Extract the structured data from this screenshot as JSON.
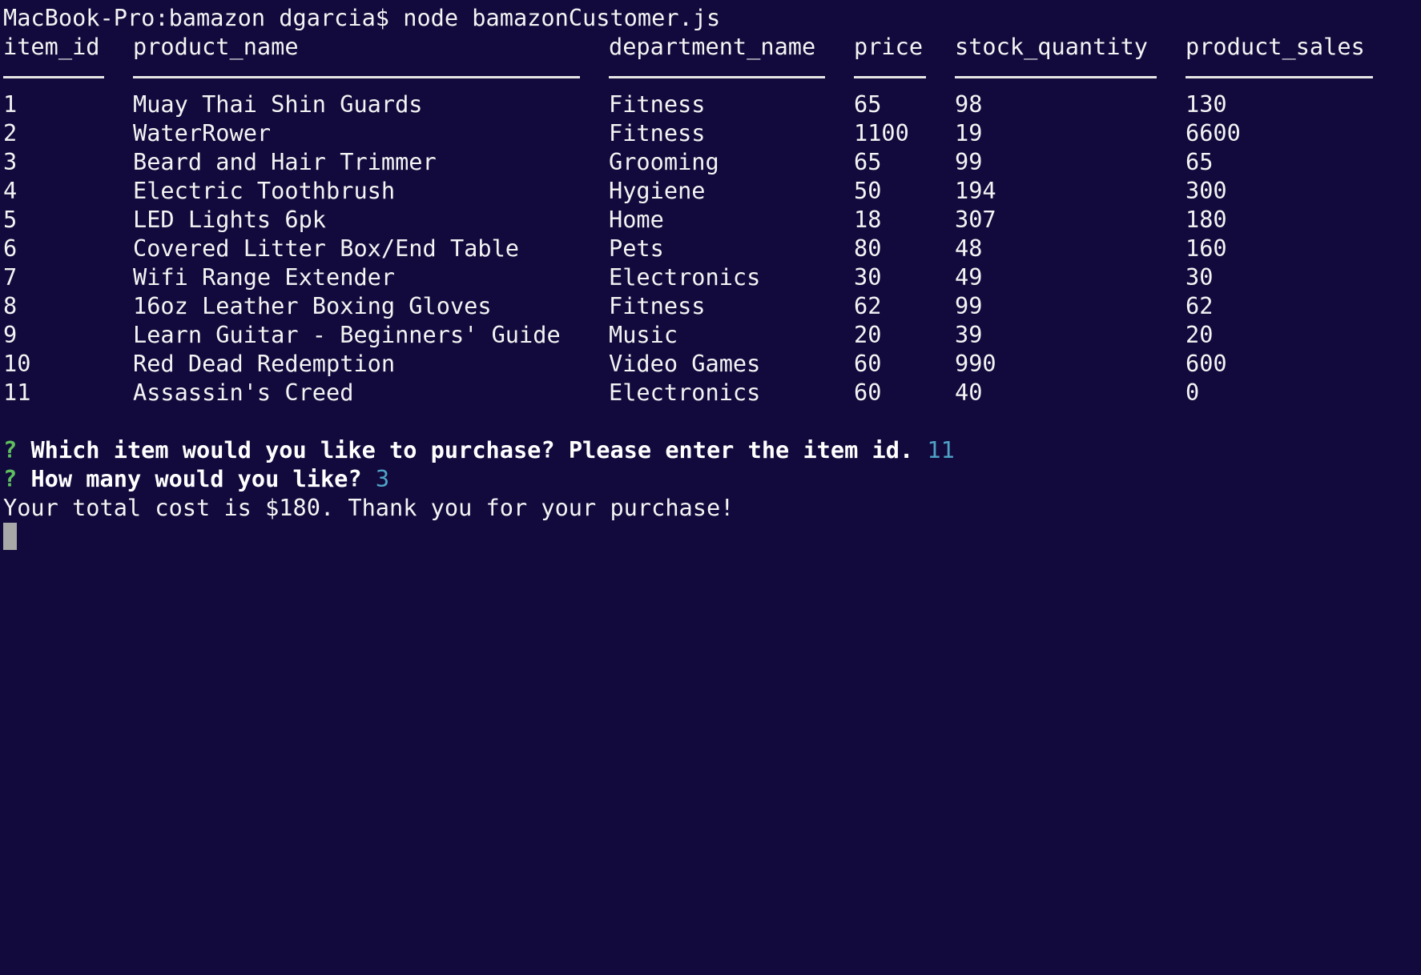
{
  "terminal": {
    "command_line": "MacBook-Pro:bamazon dgarcia$ node bamazonCustomer.js",
    "colors": {
      "background": "#120a3c",
      "foreground": "#f4f4f4",
      "prompt_mark": "#5fbf5f",
      "answer": "#4fa3c7",
      "cursor": "#a8a8a8"
    }
  },
  "table": {
    "headers": [
      "item_id",
      "product_name",
      "department_name",
      "price",
      "stock_quantity",
      "product_sales"
    ],
    "rows": [
      [
        "1",
        "Muay Thai Shin Guards",
        "Fitness",
        "65",
        "98",
        "130"
      ],
      [
        "2",
        "WaterRower",
        "Fitness",
        "1100",
        "19",
        "6600"
      ],
      [
        "3",
        "Beard and Hair Trimmer",
        "Grooming",
        "65",
        "99",
        "65"
      ],
      [
        "4",
        "Electric Toothbrush",
        "Hygiene",
        "50",
        "194",
        "300"
      ],
      [
        "5",
        "LED Lights 6pk",
        "Home",
        "18",
        "307",
        "180"
      ],
      [
        "6",
        "Covered Litter Box/End Table",
        "Pets",
        "80",
        "48",
        "160"
      ],
      [
        "7",
        "Wifi Range Extender",
        "Electronics",
        "30",
        "49",
        "30"
      ],
      [
        "8",
        "16oz Leather Boxing Gloves",
        "Fitness",
        "62",
        "99",
        "62"
      ],
      [
        "9",
        "Learn Guitar - Beginners' Guide",
        "Music",
        "20",
        "39",
        "20"
      ],
      [
        "10",
        "Red Dead Redemption",
        "Video Games",
        "60",
        "990",
        "600"
      ],
      [
        "11",
        "Assassin's Creed",
        "Electronics",
        "60",
        "40",
        "0"
      ]
    ]
  },
  "prompts": [
    {
      "mark": "?",
      "question": "Which item would you like to purchase? Please enter the item id.",
      "answer": "11"
    },
    {
      "mark": "?",
      "question": "How many would you like?",
      "answer": "3"
    }
  ],
  "result_message": "Your total cost is $180. Thank you for your purchase!"
}
